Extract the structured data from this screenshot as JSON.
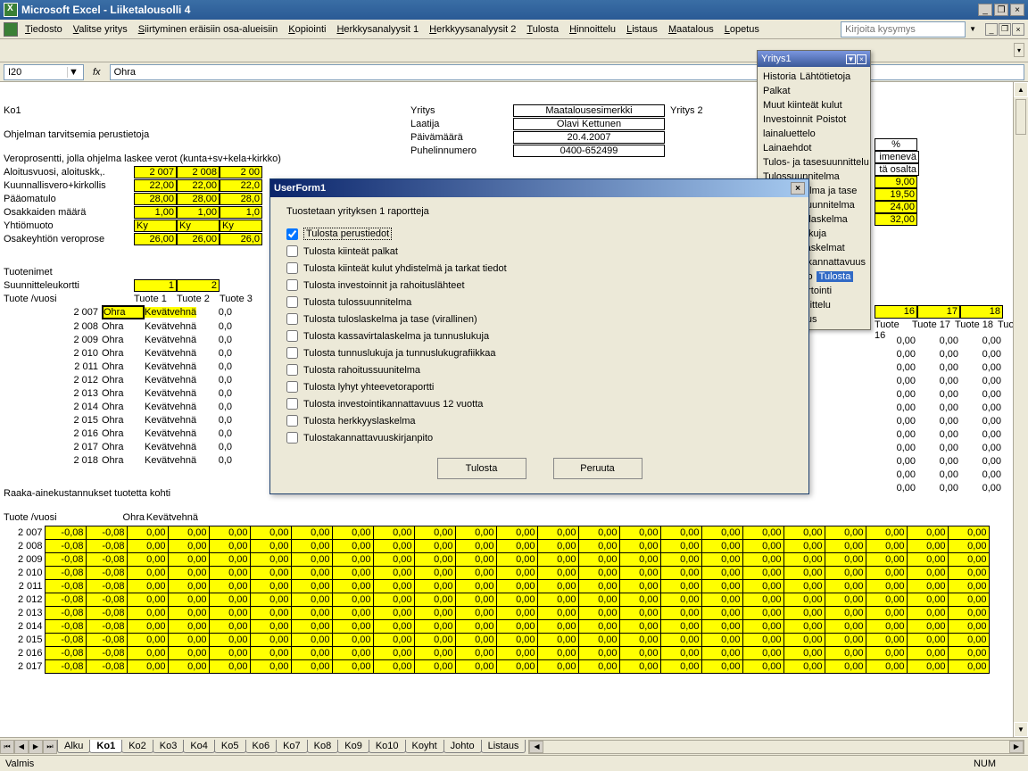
{
  "app": {
    "title": "Microsoft Excel - Liiketalousolli 4"
  },
  "menu": [
    "Tiedosto",
    "Valitse yritys",
    "Siirtyminen eräisiin osa-alueisiin",
    "Kopiointi",
    "Herkkysanalyysit 1",
    "Herkkyysanalyysit 2",
    "Tulosta",
    "Hinnoittelu",
    "Listaus",
    "Maatalous",
    "Lopetus"
  ],
  "askbox_ph": "Kirjoita kysymys",
  "namebox": "I20",
  "formula": "Ohra",
  "sheet": {
    "ko1": "Ko1",
    "ohj": "Ohjelman tarvitsemia perustietoja",
    "vero": "Veroprosentti, jolla ohjelma laskee verot (kunta+sv+kela+kirkko)",
    "rows": {
      "aloitus": "Aloitusvuosi, aloituskk,.",
      "kuunnallis": "Kuunnallisvero+kirkollis",
      "paa": "Pääomatulo",
      "osakk": "Osakkaiden määrä",
      "yht": "Yhtiömuoto",
      "osyk": "Osakeyhtiön veroprose"
    },
    "aloitus_vals": [
      "2 007",
      "2 008",
      "2 00"
    ],
    "kuun_vals": [
      "22,00",
      "22,00",
      "22,0"
    ],
    "paa_vals": [
      "28,00",
      "28,00",
      "28,0"
    ],
    "osakk_vals": [
      "1,00",
      "1,00",
      "1,0"
    ],
    "yht_vals": [
      "Ky",
      "Ky",
      "Ky"
    ],
    "osyk_vals": [
      "26,00",
      "26,00",
      "26,0"
    ],
    "yritys_lbl": "Yritys",
    "laatija_lbl": "Laatija",
    "paivam_lbl": "Päivämäärä",
    "puh_lbl": "Puhelinnumero",
    "yritys_v": "Maatalousesimerkki",
    "laatija_v": "Olavi Kettunen",
    "paivam_v": "20.4.2007",
    "puh_v": "0400-652499",
    "yritys2": "Yritys 2",
    "tuotenimet": "Tuotenimet",
    "suun": "Suunnitteleukortti",
    "tuote_vuosi": "Tuote /vuosi",
    "tuote_hdr": [
      "Tuote 1",
      "Tuote 2",
      "Tuote 3"
    ],
    "idx": [
      "1",
      "2"
    ],
    "years": [
      "2 007",
      "2 008",
      "2 009",
      "2 010",
      "2 011",
      "2 012",
      "2 013",
      "2 014",
      "2 015",
      "2 016",
      "2 017",
      "2 018"
    ],
    "ohra": "Ohra",
    "kevat": "Kevätvehnä",
    "zz": "0,0",
    "raaka": "Raaka-ainekustannukset tuotetta kohti",
    "cost_hdr": [
      "Ohra",
      "Kevätvehnä"
    ],
    "cost_years": [
      "2 007",
      "2 008",
      "2 009",
      "2 010",
      "2 011",
      "2 012",
      "2 013",
      "2 014",
      "2 015",
      "2 016",
      "2 017"
    ],
    "neg": "-0,08",
    "zero": "0,00",
    "cost_cols": 23,
    "far_idx": [
      "16",
      "17",
      "18"
    ],
    "far_hdr": [
      "Tuote 16",
      "Tuote 17",
      "Tuote 18",
      "Tuot"
    ],
    "far_right_top_cells": [
      "%",
      "imenevä",
      "tä osalta",
      "9,00",
      "19,50",
      "24,00",
      "32,00"
    ]
  },
  "dialog": {
    "title": "UserForm1",
    "sub": "Tuostetaan yrityksen 1 raportteja",
    "opts": [
      "Tulosta perustiedot",
      "Tulosta kiinteät palkat",
      "Tulosta kiinteät kulut yhdistelmä ja tarkat tiedot",
      "Tulosta investoinnit ja rahoituslähteet",
      "Tulosta tulossuunnitelma",
      "Tulosta tuloslaskelma ja tase (virallinen)",
      "Tulosta kassavirtalaskelma ja tunnuslukuja",
      "Tulosta tunnuslukuja ja tunnuslukugrafiikkaa",
      "Tulosta rahoitussuunitelma",
      "Tulosta lyhyt yhteevetoraportti",
      "Tulosta investointikannattavuus 12 vuotta",
      "Tulosta herkkyyslaskelma",
      "Tulostakannattavuuskirjanpito"
    ],
    "tulosta": "Tulosta",
    "peruuta": "Peruuta"
  },
  "panel": {
    "title": "Yritys1",
    "items": [
      [
        "Historia",
        "Lähtötietoja"
      ],
      [
        "Palkat"
      ],
      [
        "Muut kiinteät kulut"
      ],
      [
        "Investoinnit",
        "Poistot"
      ],
      [
        "lainaluettelo",
        "Lainaehdot"
      ],
      [
        "Tulos- ja tasesuunnittelu"
      ],
      [
        "Tulossuunnitelma"
      ],
      [
        "Tuloslaskelma ja tase"
      ],
      [
        "Rahoitussuunnitelma"
      ],
      [
        "Kassavirtalaskelma"
      ],
      [
        "Tunnnuslukuja"
      ],
      [
        "Herkkyyslaskelmat"
      ],
      [
        "Investointikannattavuus"
      ],
      [
        "Yhteenveto",
        "Tulosta"
      ],
      [
        "IFRS raportointi"
      ],
      [
        "Verosuunnittelu"
      ],
      [
        "Verotulostus"
      ]
    ],
    "highlight": "Tulosta"
  },
  "tabs": [
    "Alku",
    "Ko1",
    "Ko2",
    "Ko3",
    "Ko4",
    "Ko5",
    "Ko6",
    "Ko7",
    "Ko8",
    "Ko9",
    "Ko10",
    "Koyht",
    "Johto",
    "Listaus"
  ],
  "active_tab": "Ko1",
  "status": "Valmis",
  "numlock": "NUM"
}
